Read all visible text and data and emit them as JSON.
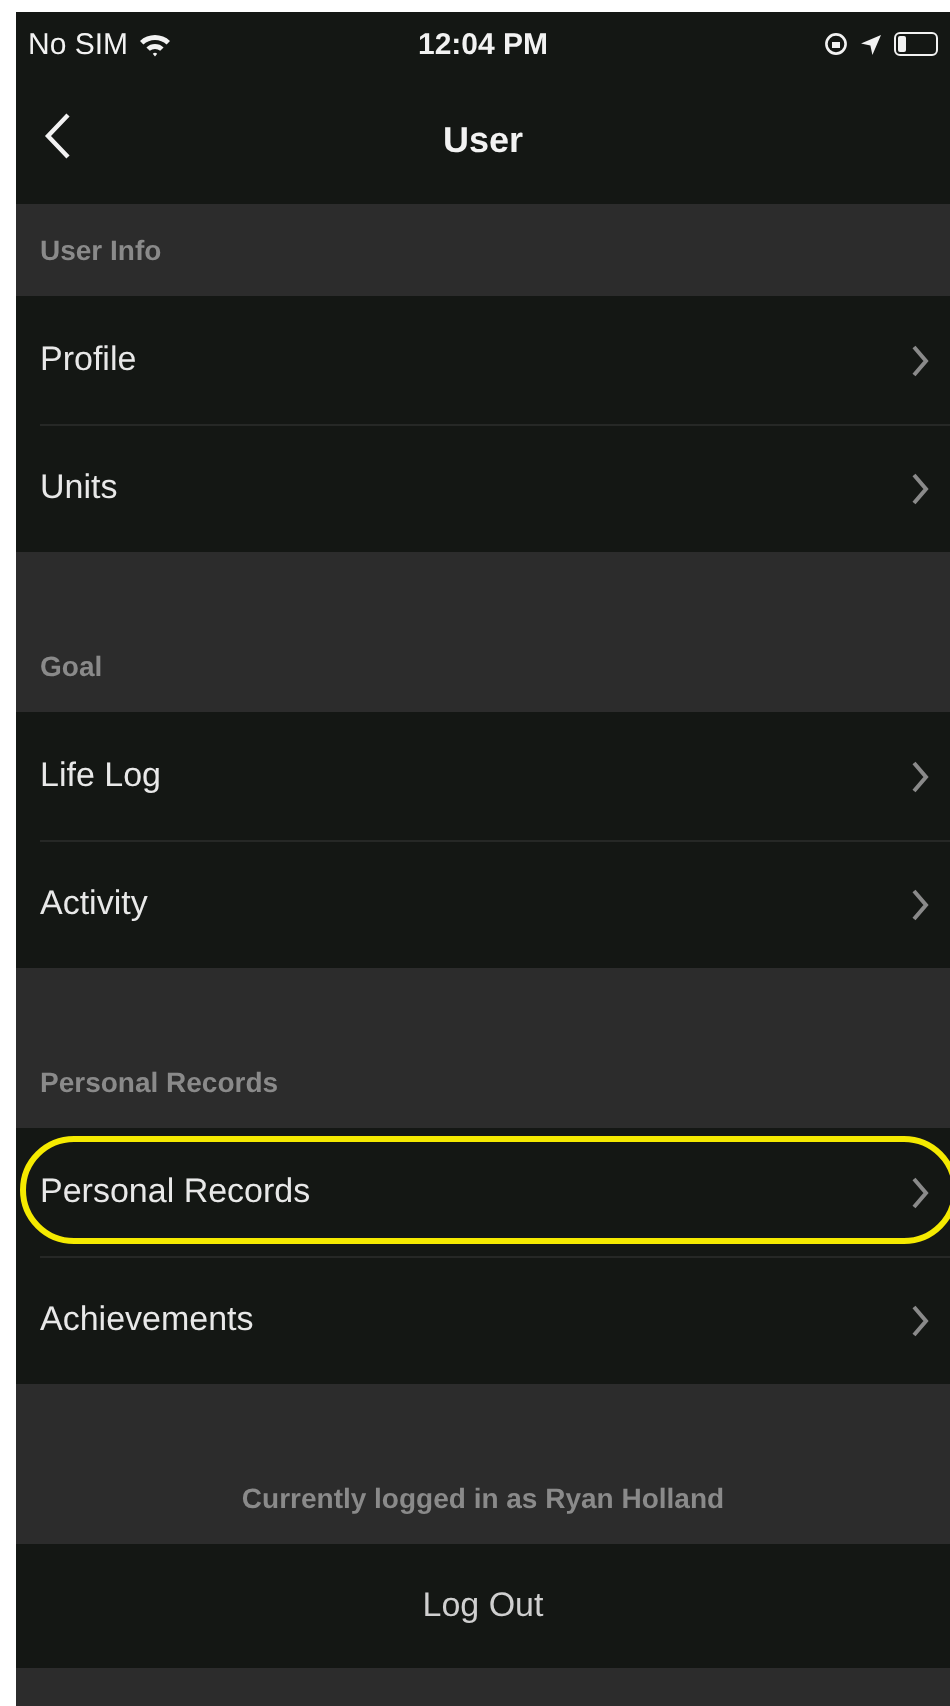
{
  "status_bar": {
    "carrier": "No SIM",
    "time": "12:04 PM"
  },
  "nav": {
    "title": "User"
  },
  "sections": [
    {
      "header": "User Info",
      "items": [
        {
          "label": "Profile",
          "highlighted": false
        },
        {
          "label": "Units",
          "highlighted": false
        }
      ]
    },
    {
      "header": "Goal",
      "items": [
        {
          "label": "Life Log",
          "highlighted": false
        },
        {
          "label": "Activity",
          "highlighted": false
        }
      ]
    },
    {
      "header": "Personal Records",
      "items": [
        {
          "label": "Personal Records",
          "highlighted": true
        },
        {
          "label": "Achievements",
          "highlighted": false
        }
      ]
    }
  ],
  "footer": {
    "login_note": "Currently logged in as Ryan Holland",
    "logout_button": "Log Out"
  }
}
